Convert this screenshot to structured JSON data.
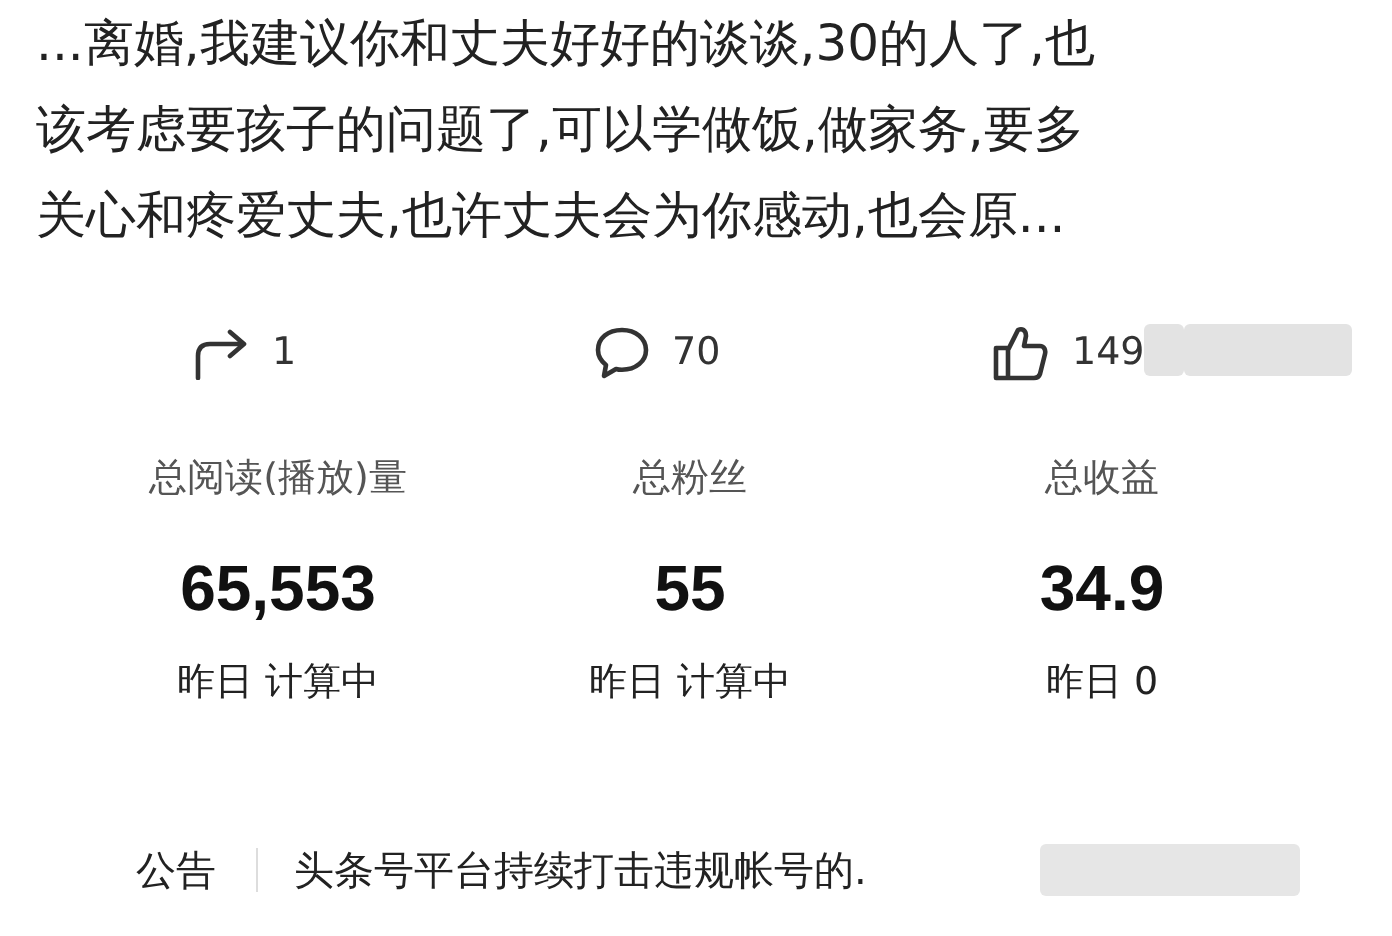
{
  "comment": {
    "lines": [
      "...离婚,我建议你和丈夫好好的谈谈,30的人了,也",
      "该考虑要孩子的问题了,可以学做饭,做家务,要多",
      "关心和疼爱丈夫,也许丈夫会为你感动,也会原..."
    ]
  },
  "actions": [
    {
      "kind": "share",
      "count": "1"
    },
    {
      "kind": "comment",
      "count": "70"
    },
    {
      "kind": "like",
      "count": "149"
    }
  ],
  "stats": [
    {
      "label": "总阅读(播放)量",
      "value": "65,553",
      "sub": "昨日 计算中"
    },
    {
      "label": "总粉丝",
      "value": "55",
      "sub": "昨日 计算中"
    },
    {
      "label": "总收益",
      "value": "34.9",
      "sub": "昨日 0"
    }
  ],
  "notice": {
    "label": "公告",
    "text": "头条号平台持续打击违规帐号的."
  }
}
